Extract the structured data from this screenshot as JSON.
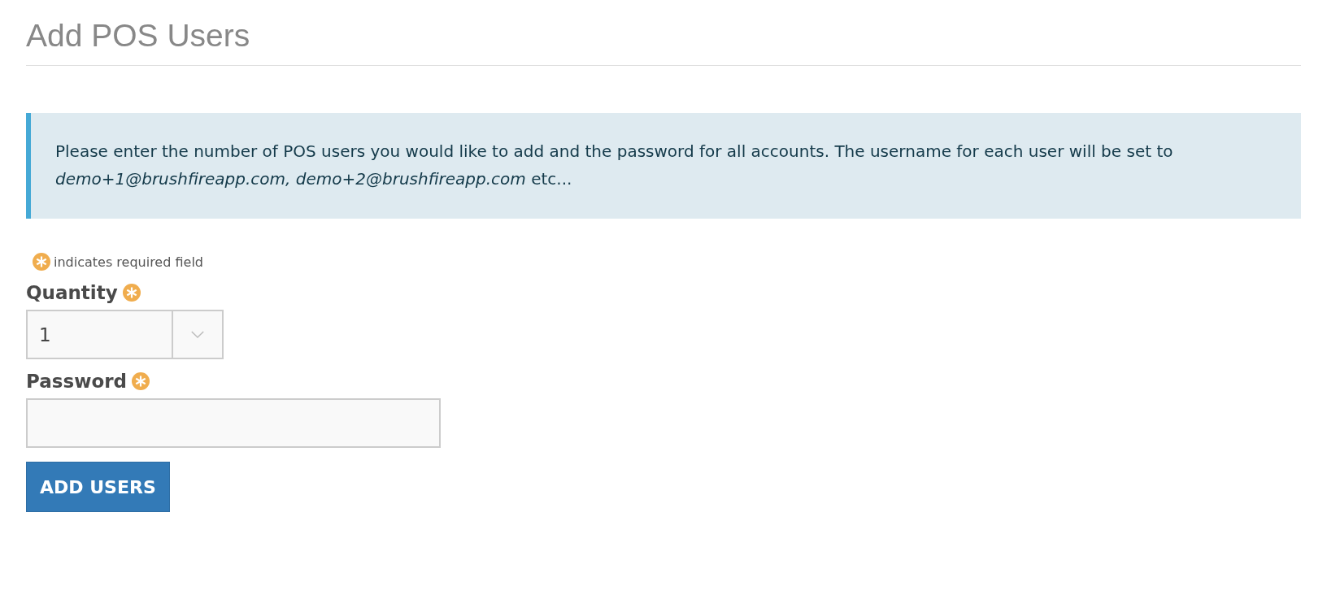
{
  "page": {
    "title": "Add POS Users"
  },
  "notice": {
    "text": "Please enter the number of POS users you would like to add and the password for all accounts. The username for each user will be set to *demo+1@brushfireapp.com, demo+2@brushfireapp.com* etc..."
  },
  "required_note": "indicates required field",
  "fields": [
    {
      "kind": "select",
      "label": "Quantity",
      "required": true,
      "value": "1"
    },
    {
      "kind": "password",
      "label": "Password",
      "required": true
    }
  ],
  "buttons": [
    "ADD USERS"
  ]
}
